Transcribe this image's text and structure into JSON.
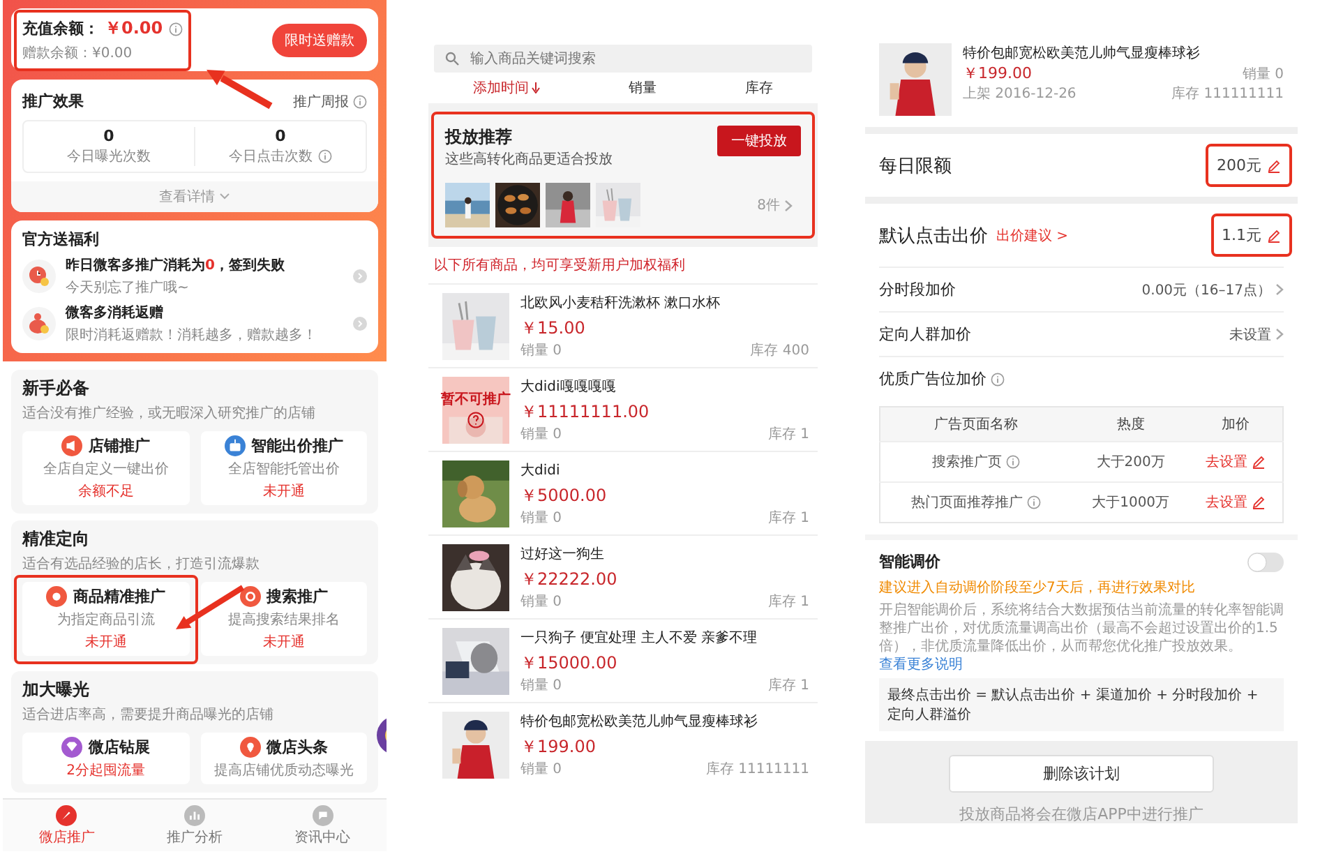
{
  "promo_home": {
    "balance": {
      "label": "充值余额：",
      "amount": "￥0.00",
      "gift": "赠款余额：¥0.00",
      "button": "限时送赠款"
    },
    "effect": {
      "title": "推广效果",
      "report_link": "推广周报",
      "stats": [
        {
          "value": "0",
          "label": "今日曝光次数"
        },
        {
          "value": "0",
          "label": "今日点击次数",
          "info": true
        }
      ],
      "details": "查看详情"
    },
    "benefits": {
      "title": "官方送福利",
      "items": [
        {
          "title": "昨日微客多推广消耗为",
          "highlight": "0",
          "title_end": "，签到失败",
          "subtitle": "今天别忘了推广哦~",
          "kind": "clock"
        },
        {
          "title": "微客多消耗返赠",
          "subtitle": "限时消耗返赠款！消耗越多，赠款越多！",
          "kind": "bag"
        }
      ]
    },
    "sections": [
      {
        "title": "新手必备",
        "subtitle": "适合没有推广经验，或无暇深入研究推广的店铺",
        "cards": [
          {
            "title": "店铺推广",
            "desc": "全店自定义一键出价",
            "status": "余额不足",
            "kind": "shop"
          },
          {
            "title": "智能出价推广",
            "desc": "全店智能托管出价",
            "status": "未开通",
            "kind": "robot"
          }
        ]
      },
      {
        "title": "精准定向",
        "subtitle": "适合有选品经验的店长，打造引流爆款",
        "cards": [
          {
            "title": "商品精准推广",
            "desc": "为指定商品引流",
            "status": "未开通",
            "kind": "goods"
          },
          {
            "title": "搜索推广",
            "desc": "提高搜索结果排名",
            "status": "未开通",
            "kind": "search"
          }
        ]
      },
      {
        "title": "加大曝光",
        "subtitle": "适合进店率高，需要提升商品曝光的店铺",
        "cards": [
          {
            "title": "微店钻展",
            "status": "2分起囤流量",
            "kind": "diamond"
          },
          {
            "title": "微店头条",
            "desc": "提高店铺优质动态曝光",
            "kind": "pin"
          }
        ]
      }
    ],
    "tabbar": [
      {
        "label": "微店推广",
        "selected": true,
        "kind": "promo"
      },
      {
        "label": "推广分析",
        "selected": false,
        "kind": "chart"
      },
      {
        "label": "资讯中心",
        "selected": false,
        "kind": "news"
      }
    ]
  },
  "product_list": {
    "search": {
      "placeholder": "输入商品关键词搜索"
    },
    "sort_tabs": [
      {
        "label": "添加时间",
        "selected": true
      },
      {
        "label": "销量",
        "selected": false
      },
      {
        "label": "库存",
        "selected": false
      }
    ],
    "recommend": {
      "title": "投放推荐",
      "subtitle": "这些高转化商品更适合投放",
      "button": "一键投放",
      "count": "8件"
    },
    "notice": "以下所有商品，均可享受新用户加权福利",
    "products": [
      {
        "name": "北欧风小麦秸秆洗漱杯 漱口水杯",
        "price": "￥15.00",
        "sales": "销量 0",
        "stock": "库存 400"
      },
      {
        "name": "大didi嘎嘎嘎嘎",
        "price": "￥11111111.00",
        "sales": "销量 0",
        "stock": "库存 1",
        "overlay": "暂不可推广"
      },
      {
        "name": "大didi",
        "price": "￥5000.00",
        "sales": "销量 0",
        "stock": "库存 1"
      },
      {
        "name": "过好这一狗生",
        "price": "￥22222.00",
        "sales": "销量 0",
        "stock": "库存 1"
      },
      {
        "name": "一只狗子 便宜处理 主人不爱 亲爹不理",
        "price": "￥15000.00",
        "sales": "销量 0",
        "stock": "库存 1"
      },
      {
        "name": "特价包邮宽松欧美范儿帅气显瘦棒球衫",
        "price": "￥199.00",
        "sales": "销量 0",
        "stock": "库存 11111111"
      }
    ]
  },
  "plan_detail": {
    "product": {
      "name": "特价包邮宽松欧美范儿帅气显瘦棒球衫",
      "price": "￥199.00",
      "listed": "上架 2016-12-26",
      "sales": "销量 0",
      "stock": "库存 111111111"
    },
    "daily_limit": {
      "label": "每日限额",
      "value": "200元"
    },
    "default_bid": {
      "label": "默认点击出价",
      "link": "出价建议 >",
      "value": "1.1元"
    },
    "settings": [
      {
        "label": "分时段加价",
        "value": "0.00元（16–17点）"
      },
      {
        "label": "定向人群加价",
        "value": "未设置"
      }
    ],
    "premium": {
      "title": "优质广告位加价",
      "columns": [
        "广告页面名称",
        "热度",
        "加价"
      ],
      "rows": [
        {
          "name": "搜索推广页",
          "heat": "大于200万",
          "action": "去设置"
        },
        {
          "name": "热门页面推荐推广",
          "heat": "大于1000万",
          "action": "去设置"
        }
      ]
    },
    "smart": {
      "title": "智能调价",
      "on": false,
      "tip": "建议进入自动调价阶段至少7天后，再进行效果对比",
      "desc": "开启智能调价后，系统将结合大数据预估当前流量的转化率智能调整推广出价，对优质流量调高出价（最高不会超过设置出价的1.5倍），非优质流量降低出价，从而帮您优化推广投放效果。",
      "more_link": "查看更多说明",
      "formula": "最终点击出价 = 默认点击出价 + 渠道加价 + 分时段加价 + 定向人群溢价"
    },
    "delete_button": "删除该计划",
    "footer": "投放商品将会在微店APP中进行推广"
  }
}
